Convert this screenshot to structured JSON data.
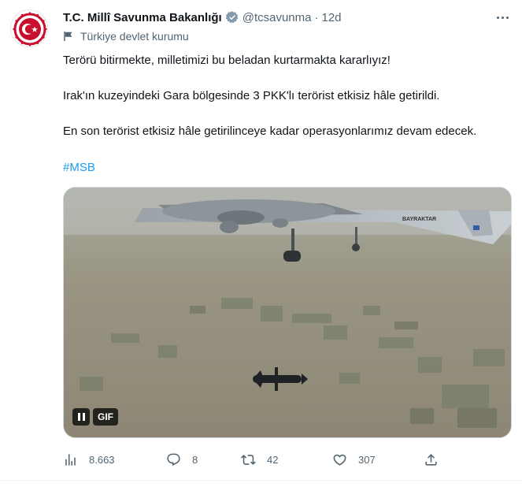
{
  "account": {
    "name": "T.C. Millî Savunma Bakanlığı",
    "handle": "@tcsavunma",
    "separator": "·",
    "time": "12d",
    "label": "Türkiye devlet kurumu",
    "verified_color": "#829aab",
    "avatar_color": "#c8102e"
  },
  "tweet": {
    "line1": "Terörü bitirmekte, milletimizi bu beladan kurtarmakta kararlıyız!",
    "line2": "Irak'ın kuzeyindeki Gara bölgesinde 3 PKK'lı terörist etkisiz hâle getirildi.",
    "line3": "En son terörist etkisiz hâle getirilinceye kadar operasyonlarımız devam edecek.",
    "hashtag": "#MSB",
    "hashtag_color": "#1d9bf0"
  },
  "media": {
    "type": "gif",
    "badge": "GIF",
    "drone_marking": "BAYRAKTAR"
  },
  "actions": {
    "views": "8.663",
    "replies": "8",
    "retweets": "42",
    "likes": "307"
  },
  "icons": {
    "more": "more-icon",
    "verified": "verified-badge-icon",
    "flag": "flag-icon",
    "views": "views-chart-icon",
    "reply": "reply-icon",
    "retweet": "retweet-icon",
    "like": "heart-icon",
    "share": "share-icon",
    "pause": "pause-icon"
  }
}
